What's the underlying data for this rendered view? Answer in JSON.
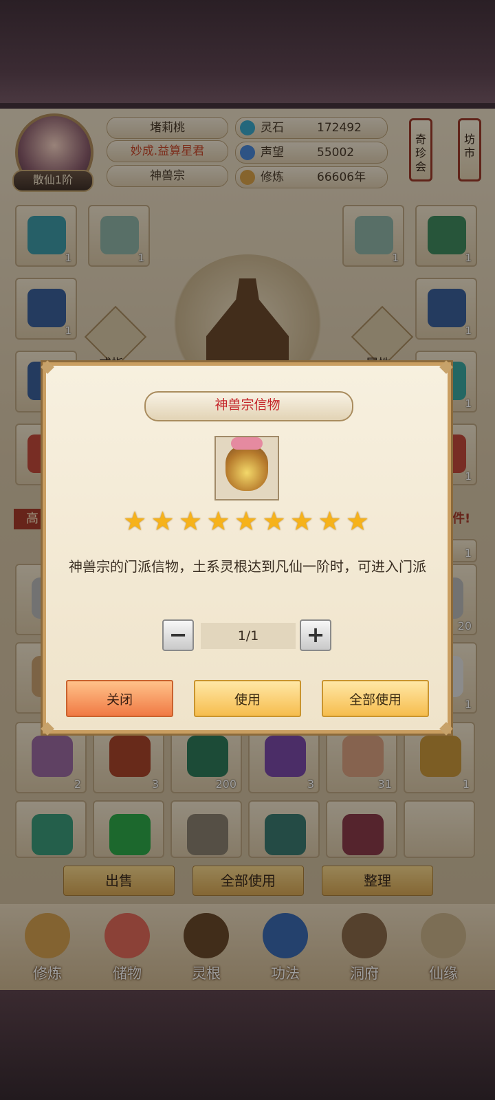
{
  "header": {
    "player_name": "堵莉桃",
    "title": "妙成.益算星君",
    "sect": "神兽宗",
    "rank": "散仙1阶",
    "stats": [
      {
        "label": "灵石",
        "value": "172492",
        "icon": "spirit-stone-icon",
        "color": "#3aa6c9"
      },
      {
        "label": "声望",
        "value": "55002",
        "icon": "prestige-icon",
        "color": "#4a86d6"
      },
      {
        "label": "修炼",
        "value": "66606年",
        "icon": "meditation-icon",
        "color": "#d9a24a"
      }
    ],
    "side_buttons": [
      "奇珍会",
      "坊市"
    ]
  },
  "equipment": {
    "ring_label": "戒指",
    "attr_label": "属性",
    "slot_counts": [
      "1",
      "1",
      "1",
      "1",
      "1",
      "1",
      "1",
      "1",
      "1",
      "1"
    ]
  },
  "background_text": {
    "left_banner": "高",
    "right_banner": "多件!"
  },
  "inventory": {
    "row_counts": [
      [
        "1",
        "20"
      ],
      [
        "1",
        "1"
      ],
      [
        "2",
        "3",
        "200",
        "3",
        "31",
        "1"
      ]
    ]
  },
  "actions": {
    "sell": "出售",
    "use_all": "全部使用",
    "sort": "整理"
  },
  "nav": [
    {
      "label": "修炼",
      "icon": "cultivation-icon"
    },
    {
      "label": "储物",
      "icon": "storage-bag-icon"
    },
    {
      "label": "灵根",
      "icon": "spirit-root-icon"
    },
    {
      "label": "功法",
      "icon": "technique-book-icon"
    },
    {
      "label": "洞府",
      "icon": "cave-dwelling-icon"
    },
    {
      "label": "仙缘",
      "icon": "immortal-fate-icon"
    }
  ],
  "modal": {
    "title": "神兽宗信物",
    "item_icon": "sect-token-bag-icon",
    "stars": 9,
    "description": "神兽宗的门派信物，土系灵根达到凡仙一阶时，可进入门派",
    "quantity": "1/1",
    "minus": "−",
    "plus": "+",
    "close": "关闭",
    "use": "使用",
    "use_all": "全部使用"
  }
}
